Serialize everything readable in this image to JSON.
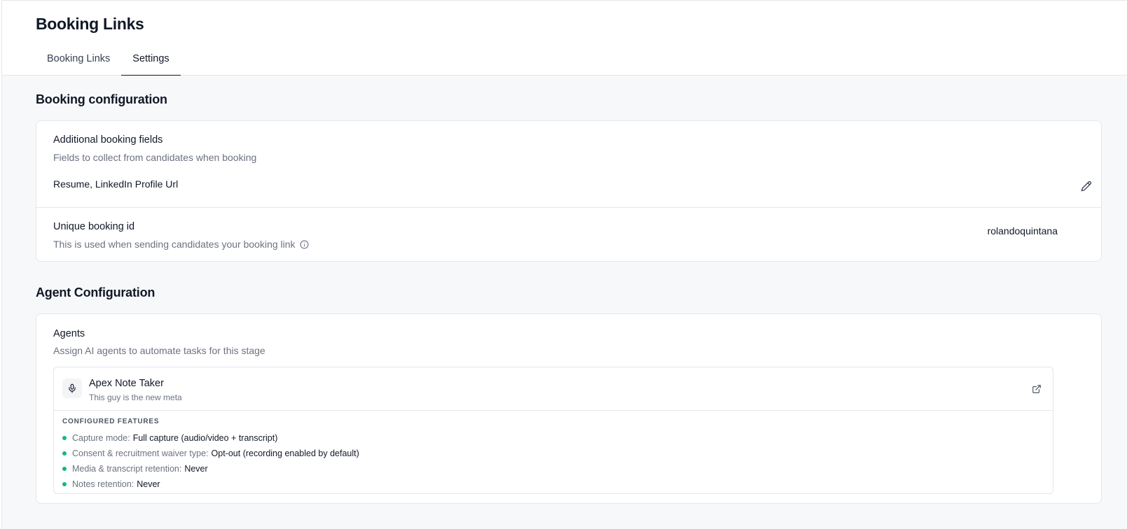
{
  "page": {
    "title": "Booking Links"
  },
  "tabs": [
    {
      "label": "Booking Links",
      "active": false
    },
    {
      "label": "Settings",
      "active": true
    }
  ],
  "booking_config": {
    "section_title": "Booking configuration",
    "additional_fields": {
      "title": "Additional booking fields",
      "subtitle": "Fields to collect from candidates when booking",
      "value": "Resume, LinkedIn Profile Url",
      "edit_icon": "pencil-icon"
    },
    "unique_id": {
      "title": "Unique booking id",
      "subtitle": "This is used when sending candidates your booking link",
      "info_icon": "info-icon",
      "value": "rolandoquintana"
    }
  },
  "agent_config": {
    "section_title": "Agent Configuration",
    "agents": {
      "title": "Agents",
      "subtitle": "Assign AI agents to automate tasks for this stage",
      "agent": {
        "icon": "microphone-icon",
        "name": "Apex Note Taker",
        "description": "This guy is the new meta",
        "open_icon": "external-link-icon",
        "features_label": "CONFIGURED FEATURES",
        "features": [
          {
            "key": "Capture mode:",
            "value": "Full capture (audio/video + transcript)"
          },
          {
            "key": "Consent & recruitment waiver type:",
            "value": "Opt-out (recording enabled by default)"
          },
          {
            "key": "Media & transcript retention:",
            "value": "Never"
          },
          {
            "key": "Notes retention:",
            "value": "Never"
          }
        ]
      }
    }
  },
  "colors": {
    "accent": "#111827",
    "feature_dot": "#10b981",
    "background": "#f7f8fa",
    "border": "#e5e7eb",
    "muted_text": "#6b7280"
  }
}
